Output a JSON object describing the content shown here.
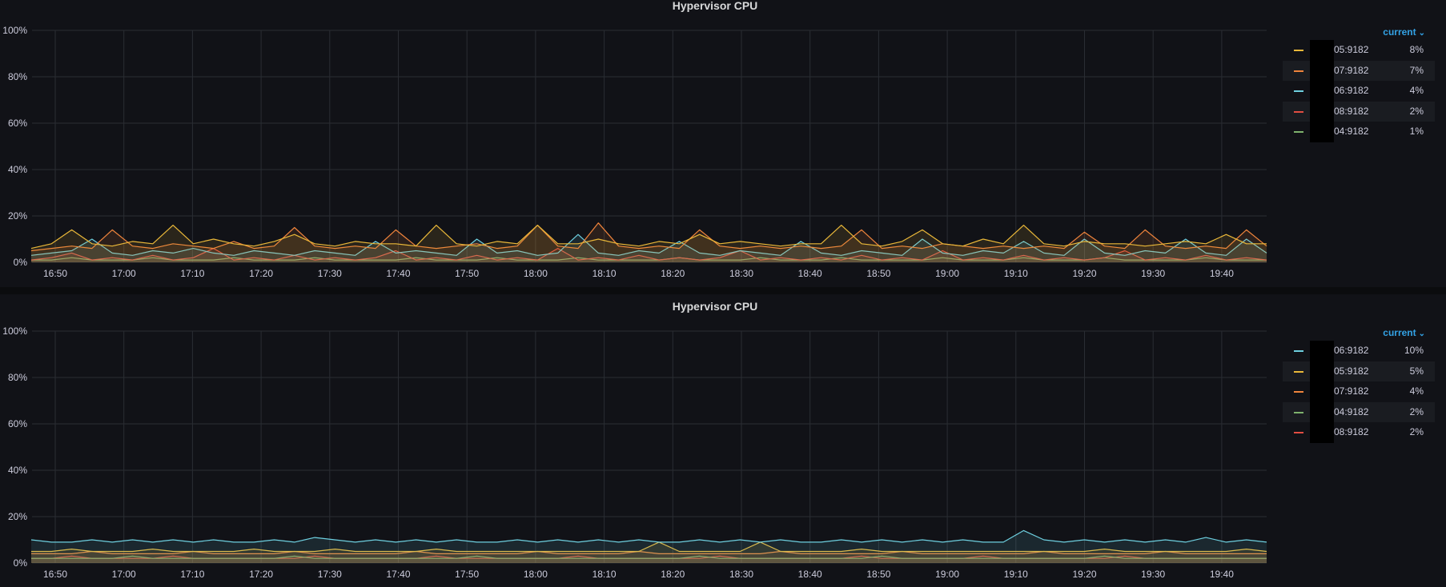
{
  "panels": [
    {
      "title": "Hypervisor CPU",
      "legend": {
        "header": "current",
        "chevron_icon": "chevron-down-icon",
        "items": [
          {
            "name": "05:9182",
            "value": "8%",
            "color": "#EAB839"
          },
          {
            "name": "07:9182",
            "value": "7%",
            "color": "#EF843C"
          },
          {
            "name": "06:9182",
            "value": "4%",
            "color": "#6ED0E0"
          },
          {
            "name": "08:9182",
            "value": "2%",
            "color": "#E24D42"
          },
          {
            "name": "04:9182",
            "value": "1%",
            "color": "#7EB26D"
          }
        ]
      }
    },
    {
      "title": "Hypervisor CPU",
      "legend": {
        "header": "current",
        "chevron_icon": "chevron-down-icon",
        "items": [
          {
            "name": "06:9182",
            "value": "10%",
            "color": "#6ED0E0"
          },
          {
            "name": "05:9182",
            "value": "5%",
            "color": "#EAB839"
          },
          {
            "name": "07:9182",
            "value": "4%",
            "color": "#EF843C"
          },
          {
            "name": "04:9182",
            "value": "2%",
            "color": "#7EB26D"
          },
          {
            "name": "08:9182",
            "value": "2%",
            "color": "#E24D42"
          }
        ]
      }
    }
  ],
  "chart_data": [
    {
      "type": "line",
      "title": "Hypervisor CPU",
      "x_ticks": [
        "16:50",
        "17:00",
        "17:10",
        "17:20",
        "17:30",
        "17:40",
        "17:50",
        "18:00",
        "18:10",
        "18:20",
        "18:30",
        "18:40",
        "18:50",
        "19:00",
        "19:10",
        "19:20",
        "19:30",
        "19:40"
      ],
      "y_ticks": [
        "0%",
        "20%",
        "40%",
        "60%",
        "80%",
        "100%"
      ],
      "ylim": [
        0,
        100
      ],
      "grid": true,
      "legend_position": "right",
      "series": [
        {
          "name": "05:9182",
          "color": "#EAB839",
          "values": [
            6,
            8,
            14,
            8,
            7,
            9,
            8,
            16,
            8,
            10,
            8,
            7,
            9,
            12,
            8,
            7,
            9,
            8,
            8,
            7,
            16,
            8,
            7,
            9,
            8,
            16,
            8,
            8,
            10,
            8,
            7,
            9,
            8,
            12,
            8,
            9,
            8,
            7,
            8,
            8,
            16,
            8,
            7,
            9,
            14,
            8,
            7,
            10,
            8,
            16,
            8,
            7,
            9,
            8,
            8,
            7,
            8,
            9,
            8,
            12,
            8,
            8
          ]
        },
        {
          "name": "07:9182",
          "color": "#EF843C",
          "values": [
            5,
            6,
            7,
            6,
            14,
            7,
            6,
            8,
            7,
            6,
            9,
            6,
            7,
            15,
            7,
            6,
            7,
            6,
            14,
            7,
            6,
            7,
            8,
            6,
            7,
            16,
            7,
            6,
            17,
            7,
            6,
            7,
            6,
            14,
            7,
            6,
            7,
            6,
            7,
            6,
            7,
            14,
            6,
            7,
            6,
            8,
            7,
            6,
            7,
            6,
            7,
            6,
            13,
            7,
            6,
            14,
            7,
            6,
            7,
            6,
            14,
            7
          ]
        },
        {
          "name": "06:9182",
          "color": "#6ED0E0",
          "values": [
            3,
            4,
            5,
            10,
            4,
            3,
            5,
            4,
            6,
            4,
            3,
            5,
            4,
            3,
            5,
            4,
            3,
            9,
            4,
            5,
            4,
            3,
            10,
            4,
            5,
            3,
            4,
            12,
            4,
            3,
            5,
            4,
            9,
            4,
            3,
            5,
            4,
            3,
            9,
            4,
            3,
            5,
            4,
            3,
            10,
            4,
            3,
            5,
            4,
            9,
            4,
            3,
            10,
            4,
            3,
            5,
            4,
            10,
            4,
            3,
            10,
            4
          ]
        },
        {
          "name": "08:9182",
          "color": "#E24D42",
          "values": [
            1,
            2,
            4,
            1,
            2,
            1,
            3,
            1,
            2,
            6,
            1,
            2,
            1,
            3,
            1,
            2,
            1,
            2,
            5,
            1,
            2,
            1,
            3,
            1,
            2,
            1,
            6,
            1,
            2,
            1,
            3,
            1,
            2,
            1,
            2,
            5,
            1,
            2,
            1,
            2,
            1,
            3,
            1,
            2,
            1,
            5,
            1,
            2,
            1,
            3,
            1,
            2,
            1,
            2,
            5,
            1,
            2,
            1,
            3,
            1,
            2,
            1
          ]
        },
        {
          "name": "04:9182",
          "color": "#7EB26D",
          "values": [
            1,
            1,
            2,
            1,
            1,
            1,
            2,
            1,
            1,
            1,
            2,
            1,
            1,
            1,
            2,
            1,
            1,
            1,
            1,
            2,
            1,
            1,
            1,
            2,
            1,
            1,
            1,
            2,
            1,
            1,
            1,
            1,
            2,
            1,
            1,
            1,
            2,
            1,
            1,
            1,
            2,
            1,
            1,
            1,
            1,
            2,
            1,
            1,
            1,
            2,
            1,
            1,
            1,
            2,
            1,
            1,
            1,
            1,
            2,
            1,
            1,
            1
          ]
        }
      ]
    },
    {
      "type": "line",
      "title": "Hypervisor CPU",
      "x_ticks": [
        "16:50",
        "17:00",
        "17:10",
        "17:20",
        "17:30",
        "17:40",
        "17:50",
        "18:00",
        "18:10",
        "18:20",
        "18:30",
        "18:40",
        "18:50",
        "19:00",
        "19:10",
        "19:20",
        "19:30",
        "19:40"
      ],
      "y_ticks": [
        "0%",
        "20%",
        "40%",
        "60%",
        "80%",
        "100%"
      ],
      "ylim": [
        0,
        100
      ],
      "grid": true,
      "legend_position": "right",
      "series": [
        {
          "name": "06:9182",
          "color": "#6ED0E0",
          "values": [
            10,
            9,
            9,
            10,
            9,
            10,
            9,
            10,
            9,
            10,
            9,
            9,
            10,
            9,
            11,
            10,
            9,
            10,
            9,
            10,
            9,
            10,
            9,
            9,
            10,
            9,
            10,
            9,
            10,
            9,
            10,
            9,
            9,
            10,
            9,
            10,
            9,
            10,
            9,
            9,
            10,
            9,
            10,
            9,
            10,
            9,
            10,
            9,
            9,
            14,
            10,
            9,
            10,
            9,
            10,
            9,
            10,
            9,
            11,
            9,
            10,
            9
          ]
        },
        {
          "name": "05:9182",
          "color": "#EAB839",
          "values": [
            5,
            5,
            6,
            5,
            5,
            5,
            6,
            5,
            5,
            5,
            5,
            6,
            5,
            5,
            5,
            6,
            5,
            5,
            5,
            5,
            6,
            5,
            5,
            5,
            5,
            5,
            5,
            5,
            5,
            5,
            5,
            9,
            5,
            5,
            5,
            5,
            9,
            5,
            5,
            5,
            5,
            6,
            5,
            5,
            5,
            5,
            5,
            5,
            5,
            5,
            5,
            5,
            5,
            6,
            5,
            5,
            5,
            5,
            5,
            5,
            6,
            5
          ]
        },
        {
          "name": "07:9182",
          "color": "#EF843C",
          "values": [
            4,
            4,
            4,
            5,
            4,
            4,
            4,
            4,
            5,
            4,
            4,
            4,
            4,
            5,
            4,
            4,
            4,
            4,
            4,
            5,
            4,
            4,
            4,
            4,
            4,
            5,
            4,
            4,
            4,
            4,
            5,
            4,
            4,
            4,
            4,
            4,
            4,
            5,
            4,
            4,
            4,
            4,
            4,
            5,
            4,
            4,
            4,
            4,
            4,
            4,
            5,
            4,
            4,
            4,
            4,
            4,
            5,
            4,
            4,
            4,
            4,
            4
          ]
        },
        {
          "name": "04:9182",
          "color": "#7EB26D",
          "values": [
            2,
            2,
            2,
            2,
            2,
            3,
            2,
            2,
            2,
            2,
            2,
            2,
            2,
            3,
            2,
            2,
            2,
            2,
            2,
            2,
            2,
            2,
            3,
            2,
            2,
            2,
            2,
            2,
            2,
            2,
            2,
            2,
            2,
            3,
            2,
            2,
            2,
            2,
            2,
            2,
            2,
            2,
            3,
            2,
            2,
            2,
            2,
            2,
            2,
            2,
            2,
            2,
            2,
            3,
            2,
            2,
            2,
            2,
            2,
            2,
            2,
            2
          ]
        },
        {
          "name": "08:9182",
          "color": "#E24D42",
          "values": [
            2,
            2,
            3,
            2,
            2,
            2,
            2,
            3,
            2,
            2,
            2,
            2,
            2,
            2,
            3,
            2,
            2,
            2,
            2,
            2,
            3,
            2,
            2,
            2,
            2,
            2,
            2,
            3,
            2,
            2,
            2,
            2,
            2,
            2,
            3,
            2,
            2,
            2,
            2,
            2,
            2,
            3,
            2,
            2,
            2,
            2,
            2,
            3,
            2,
            2,
            2,
            2,
            2,
            2,
            3,
            2,
            2,
            2,
            2,
            2,
            2,
            2
          ]
        }
      ]
    }
  ]
}
